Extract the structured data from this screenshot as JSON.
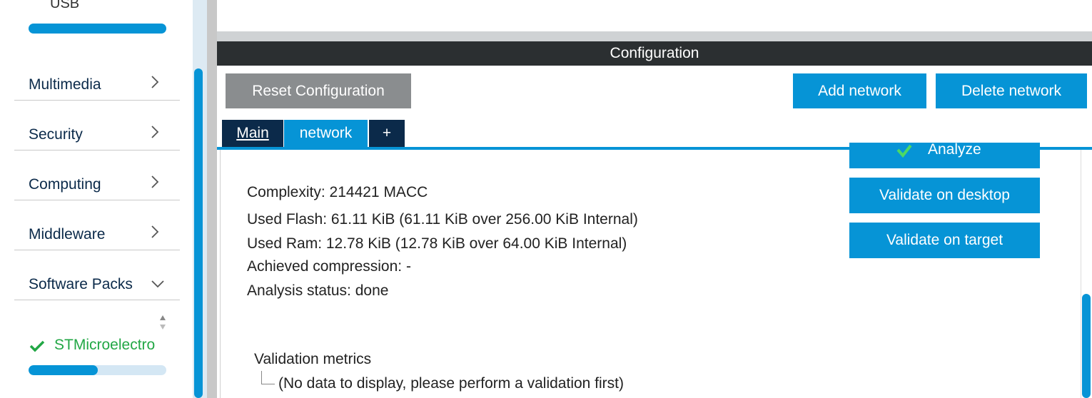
{
  "sidebar": {
    "usb_label": "USB",
    "items": [
      {
        "label": "Multimedia",
        "icon": "chevron-right-icon"
      },
      {
        "label": "Security",
        "icon": "chevron-right-icon"
      },
      {
        "label": "Computing",
        "icon": "chevron-right-icon"
      },
      {
        "label": "Middleware",
        "icon": "chevron-right-icon"
      },
      {
        "label": "Software Packs",
        "icon": "chevron-down-icon"
      }
    ],
    "pack": {
      "label": "STMicroelectro",
      "icon": "check-icon",
      "progress_fraction": 0.5
    }
  },
  "config": {
    "header": "Configuration",
    "reset_button": "Reset Configuration",
    "add_button": "Add network",
    "delete_button": "Delete network"
  },
  "tabs": {
    "main": "Main",
    "network": "network",
    "plus": "+"
  },
  "network": {
    "analyze_button": "Analyze",
    "validate_desktop": "Validate on desktop",
    "validate_target": "Validate on target",
    "complexity": "Complexity:  214421 MACC",
    "used_flash": "Used Flash: 61.11 KiB (61.11 KiB over 256.00 KiB Internal)",
    "used_ram": "Used Ram: 12.78 KiB (12.78 KiB over 64.00 KiB Internal)",
    "compression": "Achieved compression: -",
    "status": "Analysis status: done",
    "validation_title": "Validation metrics",
    "validation_note": "(No data to display, please perform a validation first)"
  },
  "colors": {
    "accent": "#0694d6",
    "dark": "#0b2a4a",
    "header": "#2b2f31",
    "success": "#22a745",
    "disabled": "#8a8d8f"
  }
}
